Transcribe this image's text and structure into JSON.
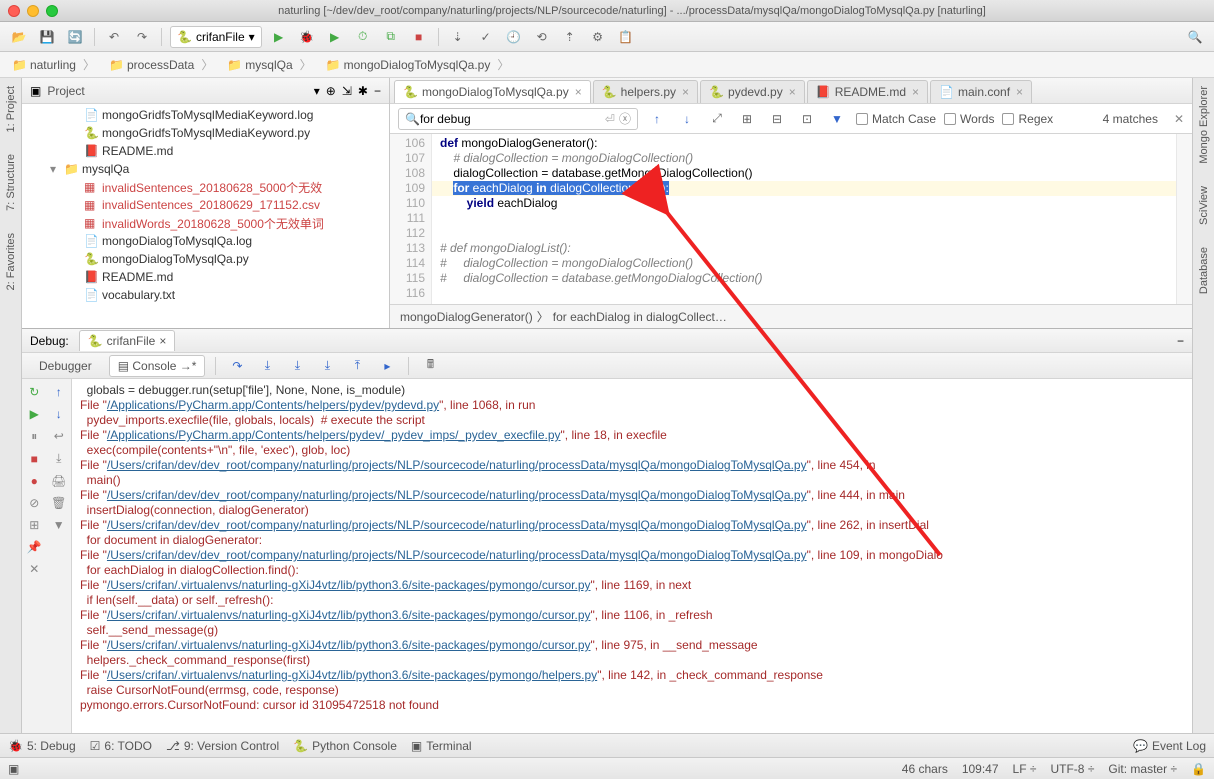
{
  "window": {
    "title": "naturling [~/dev/dev_root/company/naturling/projects/NLP/sourcecode/naturling] - .../processData/mysqlQa/mongoDialogToMysqlQa.py [naturling]"
  },
  "toolbar": {
    "run_config": "crifanFile"
  },
  "breadcrumbs": [
    "naturling",
    "processData",
    "mysqlQa",
    "mongoDialogToMysqlQa.py"
  ],
  "project": {
    "panel_title": "Project",
    "tree": [
      {
        "name": "mongoGridfsToMysqlMediaKeyword.log",
        "type": "log"
      },
      {
        "name": "mongoGridfsToMysqlMediaKeyword.py",
        "type": "py"
      },
      {
        "name": "README.md",
        "type": "md"
      },
      {
        "name": "mysqlQa",
        "type": "folder",
        "expanded": true
      },
      {
        "name": "invalidSentences_20180628_5000个无效",
        "type": "csv",
        "red": true
      },
      {
        "name": "invalidSentences_20180629_171152.csv",
        "type": "csv",
        "red": true
      },
      {
        "name": "invalidWords_20180628_5000个无效单词",
        "type": "csv",
        "red": true
      },
      {
        "name": "mongoDialogToMysqlQa.log",
        "type": "log"
      },
      {
        "name": "mongoDialogToMysqlQa.py",
        "type": "py"
      },
      {
        "name": "README.md",
        "type": "md"
      },
      {
        "name": "vocabulary.txt",
        "type": "txt"
      }
    ]
  },
  "editor": {
    "tabs": [
      {
        "name": "mongoDialogToMysqlQa.py",
        "active": true,
        "type": "py"
      },
      {
        "name": "helpers.py",
        "type": "py"
      },
      {
        "name": "pydevd.py",
        "type": "py"
      },
      {
        "name": "README.md",
        "type": "md"
      },
      {
        "name": "main.conf",
        "type": "conf"
      }
    ],
    "find": {
      "query": "for debug",
      "match_case": "Match Case",
      "words": "Words",
      "regex": "Regex",
      "matches": "4 matches"
    },
    "gutter_start": 106,
    "code_lines": [
      {
        "n": 106,
        "html": "<span class='kw'>def</span> mongoDialogGenerator():"
      },
      {
        "n": 107,
        "html": "    <span class='comment'># dialogCollection = mongoDialogCollection()</span>"
      },
      {
        "n": 108,
        "html": "    dialogCollection = database.getMongoDialogCollection()"
      },
      {
        "n": 109,
        "html": "    <span class='sel'><span class='kw'>for</span> eachDialog <span class='kw'>in</span> dialogCollection.find():</span>",
        "hl": true
      },
      {
        "n": 110,
        "html": "        <span class='kw'>yield</span> eachDialog"
      },
      {
        "n": 111,
        "html": ""
      },
      {
        "n": 112,
        "html": ""
      },
      {
        "n": 113,
        "html": "<span class='comment'># def mongoDialogList():</span>"
      },
      {
        "n": 114,
        "html": "<span class='comment'>#     dialogCollection = mongoDialogCollection()</span>"
      },
      {
        "n": 115,
        "html": "<span class='comment'>#     dialogCollection = database.getMongoDialogCollection()</span>"
      },
      {
        "n": 116,
        "html": ""
      }
    ],
    "breadcrumb_fn": "mongoDialogGenerator()",
    "breadcrumb_loop": "for eachDialog in dialogCollect…"
  },
  "debug": {
    "title": "Debug:",
    "tab": "crifanFile",
    "subtabs": {
      "debugger": "Debugger",
      "console": "Console"
    },
    "console_lines": [
      {
        "t": "  globals = debugger.run(setup['file'], None, None, is_module)",
        "cls": ""
      },
      {
        "t": "File \"",
        "link": "/Applications/PyCharm.app/Contents/helpers/pydev/pydevd.py",
        "after": "\", line 1068, in run"
      },
      {
        "t": "  pydev_imports.execfile(file, globals, locals)  # execute the script",
        "cls": "indent"
      },
      {
        "t": "File \"",
        "link": "/Applications/PyCharm.app/Contents/helpers/pydev/_pydev_imps/_pydev_execfile.py",
        "after": "\", line 18, in execfile"
      },
      {
        "t": "  exec(compile(contents+\"\\n\", file, 'exec'), glob, loc)",
        "cls": "indent"
      },
      {
        "t": "File \"",
        "link": "/Users/crifan/dev/dev_root/company/naturling/projects/NLP/sourcecode/naturling/processData/mysqlQa/mongoDialogToMysqlQa.py",
        "after": "\", line 454, in <module>"
      },
      {
        "t": "  main()",
        "cls": "indent"
      },
      {
        "t": "File \"",
        "link": "/Users/crifan/dev/dev_root/company/naturling/projects/NLP/sourcecode/naturling/processData/mysqlQa/mongoDialogToMysqlQa.py",
        "after": "\", line 444, in main"
      },
      {
        "t": "  insertDialog(connection, dialogGenerator)",
        "cls": "indent"
      },
      {
        "t": "File \"",
        "link": "/Users/crifan/dev/dev_root/company/naturling/projects/NLP/sourcecode/naturling/processData/mysqlQa/mongoDialogToMysqlQa.py",
        "after": "\", line 262, in insertDial"
      },
      {
        "t": "  for document in dialogGenerator:",
        "cls": "indent"
      },
      {
        "t": "File \"",
        "link": "/Users/crifan/dev/dev_root/company/naturling/projects/NLP/sourcecode/naturling/processData/mysqlQa/mongoDialogToMysqlQa.py",
        "after": "\", line 109, in mongoDialo"
      },
      {
        "t": "  for eachDialog in dialogCollection.find():",
        "cls": "indent"
      },
      {
        "t": "File \"",
        "link": "/Users/crifan/.virtualenvs/naturling-gXiJ4vtz/lib/python3.6/site-packages/pymongo/cursor.py",
        "after": "\", line 1169, in next"
      },
      {
        "t": "  if len(self.__data) or self._refresh():",
        "cls": "indent"
      },
      {
        "t": "File \"",
        "link": "/Users/crifan/.virtualenvs/naturling-gXiJ4vtz/lib/python3.6/site-packages/pymongo/cursor.py",
        "after": "\", line 1106, in _refresh"
      },
      {
        "t": "  self.__send_message(g)",
        "cls": "indent"
      },
      {
        "t": "File \"",
        "link": "/Users/crifan/.virtualenvs/naturling-gXiJ4vtz/lib/python3.6/site-packages/pymongo/cursor.py",
        "after": "\", line 975, in __send_message"
      },
      {
        "t": "  helpers._check_command_response(first)",
        "cls": "indent"
      },
      {
        "t": "File \"",
        "link": "/Users/crifan/.virtualenvs/naturling-gXiJ4vtz/lib/python3.6/site-packages/pymongo/helpers.py",
        "after": "\", line 142, in _check_command_response"
      },
      {
        "t": "  raise CursorNotFound(errmsg, code, response)",
        "cls": "indent"
      },
      {
        "t": "pymongo.errors.CursorNotFound: cursor id 31095472518 not found",
        "cls": "err"
      }
    ]
  },
  "tool_windows": {
    "debug": "5: Debug",
    "todo": "6: TODO",
    "vcs": "9: Version Control",
    "pyconsole": "Python Console",
    "terminal": "Terminal",
    "eventlog": "Event Log"
  },
  "statusbar": {
    "chars": "46 chars",
    "pos": "109:47",
    "lf": "LF",
    "sep": "÷",
    "enc": "UTF-8",
    "sep2": "÷",
    "git": "Git: master",
    "sep3": "÷"
  },
  "left_tools": [
    "1: Project",
    "7: Structure",
    "2: Favorites"
  ],
  "right_tools": [
    "Mongo Explorer",
    "SciView",
    "Database"
  ]
}
